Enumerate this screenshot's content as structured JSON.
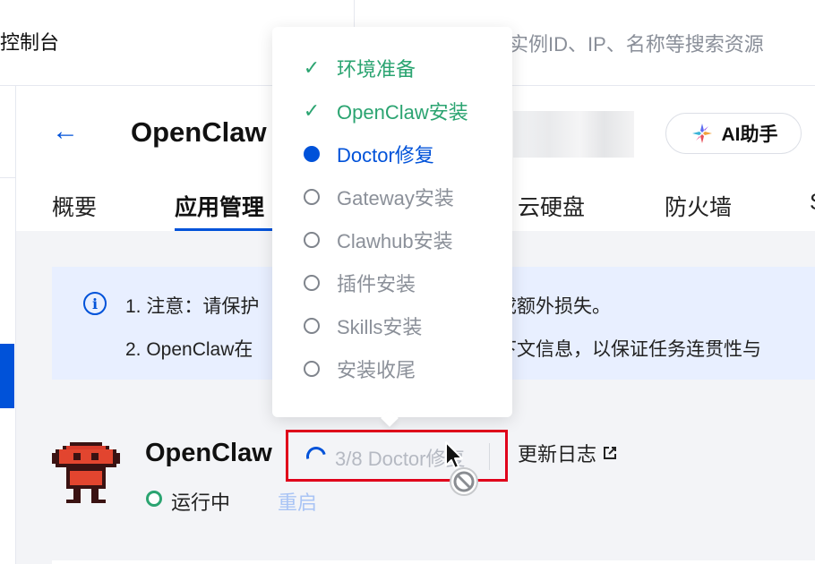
{
  "topbar": {
    "console_label": "控制台",
    "search_placeholder": "实例ID、IP、名称等搜索资源"
  },
  "header": {
    "back_icon": "←",
    "title": "OpenClaw",
    "ai_button_label": "AI助手"
  },
  "tabs": [
    {
      "label": "概要"
    },
    {
      "label": "应用管理",
      "active": true
    },
    {
      "label": "云硬盘"
    },
    {
      "label": "防火墙"
    },
    {
      "label": "S"
    }
  ],
  "notice": {
    "line1_start": "1. 注意：请保护",
    "line1_end": "成额外损失。",
    "line2_start": "2. OpenClaw在",
    "line2_end": "下文信息，以保证任务连贯性与"
  },
  "app": {
    "name": "OpenClaw",
    "status": "运行中",
    "restart_label": "重启",
    "progress_label": "3/8 Doctor修复",
    "changelog_label": "更新日志"
  },
  "install_steps": [
    {
      "label": "环境准备",
      "state": "done"
    },
    {
      "label": "OpenClaw安装",
      "state": "done"
    },
    {
      "label": "Doctor修复",
      "state": "active"
    },
    {
      "label": "Gateway安装",
      "state": "pending"
    },
    {
      "label": "Clawhub安装",
      "state": "pending"
    },
    {
      "label": "插件安装",
      "state": "pending"
    },
    {
      "label": "Skills安装",
      "state": "pending"
    },
    {
      "label": "安装收尾",
      "state": "pending"
    }
  ],
  "colors": {
    "brand": "#0052d9",
    "success": "#2ba471",
    "highlight_border": "#e0001b"
  }
}
